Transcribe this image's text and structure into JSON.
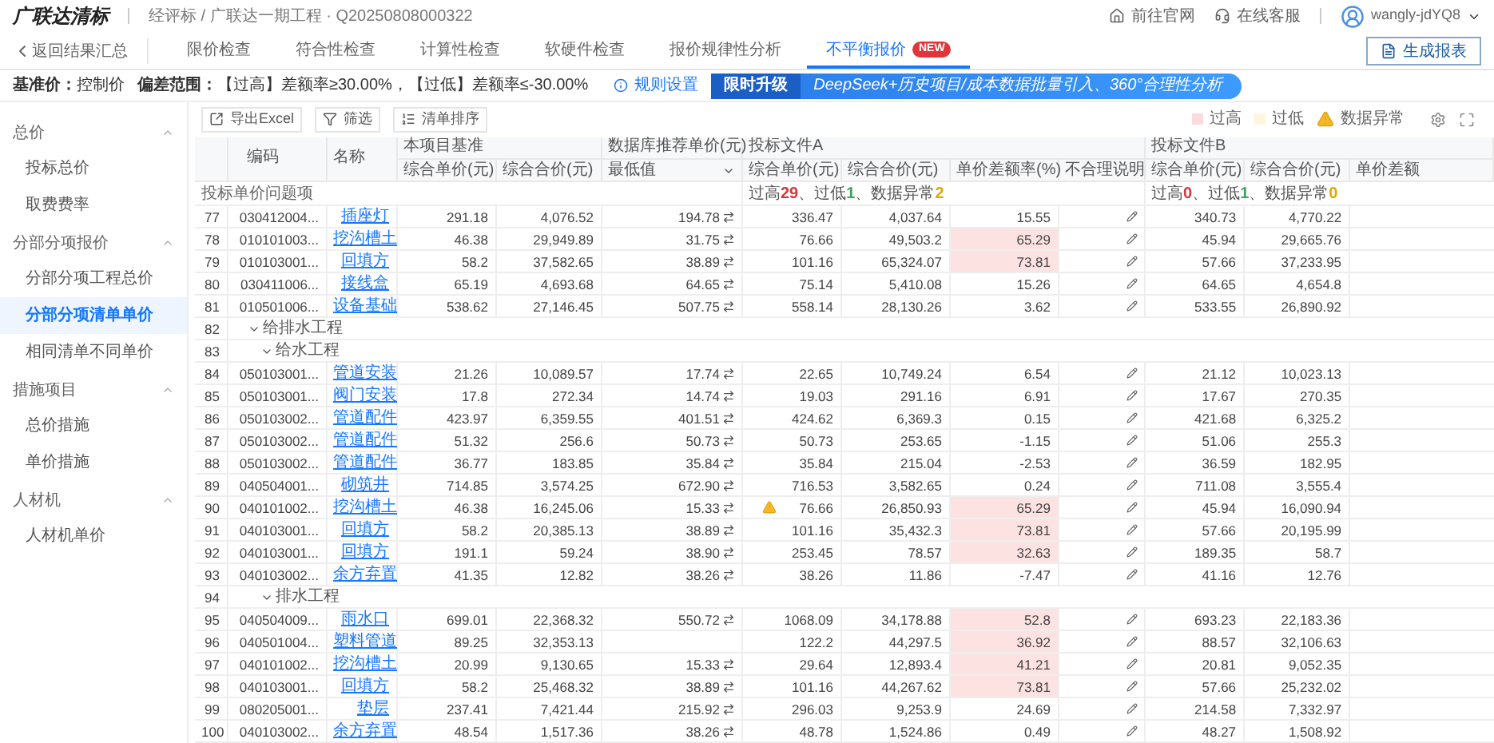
{
  "header": {
    "brand": "广联达清标",
    "breadcrumb": "经评标 / 广联达一期工程 · Q20250808000322",
    "links": [
      "前往官网",
      "在线客服"
    ],
    "user": "wangly-jdYQ8"
  },
  "nav": {
    "back": "返回结果汇总",
    "report_button": "生成报表",
    "tabs": [
      {
        "label": "限价检查",
        "selected": false
      },
      {
        "label": "符合性检查",
        "selected": false
      },
      {
        "label": "计算性检查",
        "selected": false
      },
      {
        "label": "软硬件检查",
        "selected": false
      },
      {
        "label": "报价规律性分析",
        "selected": false
      },
      {
        "label": "不平衡报价",
        "selected": true,
        "badge": "NEW"
      }
    ]
  },
  "criteria": {
    "base_label": "基准价：",
    "base_value": "控制价",
    "range_label": "偏差范围：",
    "range_value": "【过高】差额率≥30.00%，【过低】差额率≤-30.00%",
    "rule_link": "规则设置",
    "promo_tag": "限时升级",
    "promo_text": "DeepSeek+历史项目/成本数据批量引入、360°合理性分析"
  },
  "sidebar": {
    "groups": [
      {
        "label": "总价",
        "expanded": true,
        "items": [
          {
            "label": "投标总价",
            "selected": false
          },
          {
            "label": "取费费率",
            "selected": false
          }
        ]
      },
      {
        "label": "分部分项报价",
        "expanded": true,
        "items": [
          {
            "label": "分部分项工程总价",
            "selected": false
          },
          {
            "label": "分部分项清单单价",
            "selected": true
          },
          {
            "label": "相同清单不同单价",
            "selected": false
          }
        ]
      },
      {
        "label": "措施项目",
        "expanded": true,
        "items": [
          {
            "label": "总价措施",
            "selected": false
          },
          {
            "label": "单价措施",
            "selected": false
          }
        ]
      },
      {
        "label": "人材机",
        "expanded": true,
        "items": [
          {
            "label": "人材机单价",
            "selected": false
          }
        ]
      }
    ]
  },
  "toolbar": {
    "buttons": [
      "导出Excel",
      "筛选",
      "清单排序"
    ],
    "legend": [
      {
        "kind": "high",
        "label": "过高"
      },
      {
        "kind": "low",
        "label": "过低"
      },
      {
        "kind": "warning",
        "label": "数据异常"
      }
    ]
  },
  "table": {
    "code_header": "编码",
    "name_header": "名称",
    "base": {
      "title": "本项目基准",
      "columns": [
        "综合单价(元)",
        "综合合价(元)"
      ]
    },
    "db": {
      "title": "数据库推荐单价(元)",
      "option": "最低值"
    },
    "issues_label": "投标单价问题项",
    "bidders": [
      {
        "title": "投标文件A",
        "columns": [
          "综合单价(元)",
          "综合合价(元)",
          "单价差额率(%)",
          "不合理说明"
        ],
        "summary": [
          {
            "label": "过高",
            "value": "29",
            "color": "#d9363e"
          },
          {
            "label": "、过低",
            "value": "1",
            "color": "#3aa65a"
          },
          {
            "label": "、数据异常",
            "value": "2",
            "color": "#e0a800"
          }
        ]
      },
      {
        "title": "投标文件B",
        "columns": [
          "综合单价(元)",
          "综合合价(元)",
          "单价差额"
        ],
        "summary": [
          {
            "label": "过高",
            "value": "0",
            "color": "#d9363e"
          },
          {
            "label": "、过低",
            "value": "1",
            "color": "#3aa65a"
          },
          {
            "label": "、数据异常",
            "value": "0",
            "color": "#e0a800"
          }
        ]
      }
    ],
    "rows": [
      {
        "kind": "item",
        "index": "77",
        "code": "030412004...",
        "name": "插座灯",
        "base_unit": "291.18",
        "base_total": "4,076.52",
        "db_price": "194.78",
        "warning": false,
        "a_unit": "336.47",
        "a_total": "4,037.64",
        "a_rate": "15.55",
        "a_high": false,
        "b_unit": "340.73",
        "b_total": "4,770.22"
      },
      {
        "kind": "item",
        "index": "78",
        "code": "010101003...",
        "name": "挖沟槽土",
        "base_unit": "46.38",
        "base_total": "29,949.89",
        "db_price": "31.75",
        "warning": false,
        "a_unit": "76.66",
        "a_total": "49,503.2",
        "a_rate": "65.29",
        "a_high": true,
        "b_unit": "45.94",
        "b_total": "29,665.76"
      },
      {
        "kind": "item",
        "index": "79",
        "code": "010103001...",
        "name": "回填方",
        "base_unit": "58.2",
        "base_total": "37,582.65",
        "db_price": "38.89",
        "warning": false,
        "a_unit": "101.16",
        "a_total": "65,324.07",
        "a_rate": "73.81",
        "a_high": true,
        "b_unit": "57.66",
        "b_total": "37,233.95"
      },
      {
        "kind": "item",
        "index": "80",
        "code": "030411006...",
        "name": "接线盒",
        "base_unit": "65.19",
        "base_total": "4,693.68",
        "db_price": "64.65",
        "warning": false,
        "a_unit": "75.14",
        "a_total": "5,410.08",
        "a_rate": "15.26",
        "a_high": false,
        "b_unit": "64.65",
        "b_total": "4,654.8"
      },
      {
        "kind": "item",
        "index": "81",
        "code": "010501006...",
        "name": "设备基础",
        "base_unit": "538.62",
        "base_total": "27,146.45",
        "db_price": "507.75",
        "warning": false,
        "a_unit": "558.14",
        "a_total": "28,130.26",
        "a_rate": "3.62",
        "a_high": false,
        "b_unit": "533.55",
        "b_total": "26,890.92"
      },
      {
        "kind": "group",
        "index": "82",
        "label": "给排水工程",
        "expanded": true,
        "children": [
          {
            "kind": "group",
            "index": "83",
            "label": "给水工程",
            "expanded": true,
            "children": [
              {
                "kind": "item",
                "index": "84",
                "code": "050103001...",
                "name": "管道安装",
                "base_unit": "21.26",
                "base_total": "10,089.57",
                "db_price": "17.74",
                "warning": false,
                "a_unit": "22.65",
                "a_total": "10,749.24",
                "a_rate": "6.54",
                "a_high": false,
                "b_unit": "21.12",
                "b_total": "10,023.13"
              },
              {
                "kind": "item",
                "index": "85",
                "code": "050103001...",
                "name": "阀门安装",
                "base_unit": "17.8",
                "base_total": "272.34",
                "db_price": "14.74",
                "warning": false,
                "a_unit": "19.03",
                "a_total": "291.16",
                "a_rate": "6.91",
                "a_high": false,
                "b_unit": "17.67",
                "b_total": "270.35"
              },
              {
                "kind": "item",
                "index": "86",
                "code": "050103002...",
                "name": "管道配件",
                "base_unit": "423.97",
                "base_total": "6,359.55",
                "db_price": "401.51",
                "warning": false,
                "a_unit": "424.62",
                "a_total": "6,369.3",
                "a_rate": "0.15",
                "a_high": false,
                "b_unit": "421.68",
                "b_total": "6,325.2"
              },
              {
                "kind": "item",
                "index": "87",
                "code": "050103002...",
                "name": "管道配件",
                "base_unit": "51.32",
                "base_total": "256.6",
                "db_price": "50.73",
                "warning": false,
                "a_unit": "50.73",
                "a_total": "253.65",
                "a_rate": "-1.15",
                "a_high": false,
                "b_unit": "51.06",
                "b_total": "255.3"
              },
              {
                "kind": "item",
                "index": "88",
                "code": "050103002...",
                "name": "管道配件",
                "base_unit": "36.77",
                "base_total": "183.85",
                "db_price": "35.84",
                "warning": false,
                "a_unit": "35.84",
                "a_total": "215.04",
                "a_rate": "-2.53",
                "a_high": false,
                "b_unit": "36.59",
                "b_total": "182.95"
              },
              {
                "kind": "item",
                "index": "89",
                "code": "040504001...",
                "name": "砌筑井",
                "base_unit": "714.85",
                "base_total": "3,574.25",
                "db_price": "672.90",
                "warning": false,
                "a_unit": "716.53",
                "a_total": "3,582.65",
                "a_rate": "0.24",
                "a_high": false,
                "b_unit": "711.08",
                "b_total": "3,555.4"
              },
              {
                "kind": "item",
                "index": "90",
                "code": "040101002...",
                "name": "挖沟槽土",
                "base_unit": "46.38",
                "base_total": "16,245.06",
                "db_price": "15.33",
                "warning": true,
                "a_unit": "76.66",
                "a_total": "26,850.93",
                "a_rate": "65.29",
                "a_high": true,
                "b_unit": "45.94",
                "b_total": "16,090.94"
              },
              {
                "kind": "item",
                "index": "91",
                "code": "040103001...",
                "name": "回填方",
                "base_unit": "58.2",
                "base_total": "20,385.13",
                "db_price": "38.89",
                "warning": false,
                "a_unit": "101.16",
                "a_total": "35,432.3",
                "a_rate": "73.81",
                "a_high": true,
                "b_unit": "57.66",
                "b_total": "20,195.99"
              },
              {
                "kind": "item",
                "index": "92",
                "code": "040103001...",
                "name": "回填方",
                "base_unit": "191.1",
                "base_total": "59.24",
                "db_price": "38.90",
                "warning": false,
                "a_unit": "253.45",
                "a_total": "78.57",
                "a_rate": "32.63",
                "a_high": true,
                "b_unit": "189.35",
                "b_total": "58.7"
              },
              {
                "kind": "item",
                "index": "93",
                "code": "040103002...",
                "name": "余方弃置",
                "base_unit": "41.35",
                "base_total": "12.82",
                "db_price": "38.26",
                "warning": false,
                "a_unit": "38.26",
                "a_total": "11.86",
                "a_rate": "-7.47",
                "a_high": false,
                "b_unit": "41.16",
                "b_total": "12.76"
              }
            ]
          },
          {
            "kind": "group",
            "index": "94",
            "label": "排水工程",
            "expanded": true,
            "children": [
              {
                "kind": "item",
                "index": "95",
                "code": "040504009...",
                "name": "雨水口",
                "base_unit": "699.01",
                "base_total": "22,368.32",
                "db_price": "550.72",
                "warning": false,
                "a_unit": "1068.09",
                "a_total": "34,178.88",
                "a_rate": "52.8",
                "a_high": true,
                "b_unit": "693.23",
                "b_total": "22,183.36"
              },
              {
                "kind": "item",
                "index": "96",
                "code": "040501004...",
                "name": "塑料管道",
                "base_unit": "89.25",
                "base_total": "32,353.13",
                "warning": false,
                "a_unit": "122.2",
                "a_total": "44,297.5",
                "a_rate": "36.92",
                "a_high": true,
                "b_unit": "88.57",
                "b_total": "32,106.63"
              },
              {
                "kind": "item",
                "index": "97",
                "code": "040101002...",
                "name": "挖沟槽土",
                "base_unit": "20.99",
                "base_total": "9,130.65",
                "db_price": "15.33",
                "warning": false,
                "a_unit": "29.64",
                "a_total": "12,893.4",
                "a_rate": "41.21",
                "a_high": true,
                "b_unit": "20.81",
                "b_total": "9,052.35"
              },
              {
                "kind": "item",
                "index": "98",
                "code": "040103001...",
                "name": "回填方",
                "base_unit": "58.2",
                "base_total": "25,468.32",
                "db_price": "38.89",
                "warning": false,
                "a_unit": "101.16",
                "a_total": "44,267.62",
                "a_rate": "73.81",
                "a_high": true,
                "b_unit": "57.66",
                "b_total": "25,232.02"
              },
              {
                "kind": "item",
                "index": "99",
                "code": "080205001...",
                "name": "垫层",
                "base_unit": "237.41",
                "base_total": "7,421.44",
                "db_price": "215.92",
                "warning": false,
                "a_unit": "296.03",
                "a_total": "9,253.9",
                "a_rate": "24.69",
                "a_high": false,
                "b_unit": "214.58",
                "b_total": "7,332.97"
              },
              {
                "kind": "item",
                "index": "100",
                "code": "040103002...",
                "name": "余方弃置",
                "base_unit": "48.54",
                "base_total": "1,517.36",
                "db_price": "38.26",
                "warning": false,
                "a_unit": "48.78",
                "a_total": "1,524.86",
                "a_rate": "0.49",
                "a_high": false,
                "b_unit": "48.27",
                "b_total": "1,508.92"
              }
            ]
          }
        ]
      }
    ]
  }
}
